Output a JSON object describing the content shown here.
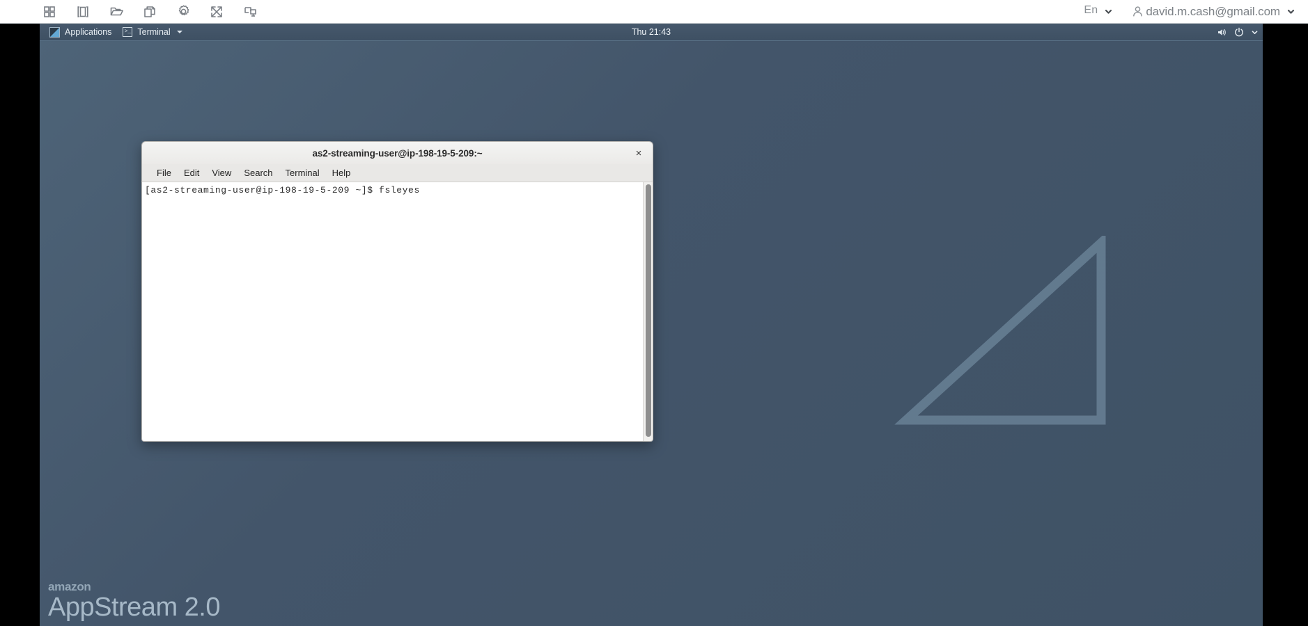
{
  "appstream_toolbar": {
    "icons": [
      {
        "name": "grid-apps-icon",
        "title": "Applications grid"
      },
      {
        "name": "window-panel-icon",
        "title": "Toggle panel"
      },
      {
        "name": "folder-open-icon",
        "title": "My Files"
      },
      {
        "name": "copy-pages-icon",
        "title": "Clipboard"
      },
      {
        "name": "gear-icon",
        "title": "Settings"
      },
      {
        "name": "fullscreen-expand-icon",
        "title": "Fullscreen"
      },
      {
        "name": "multi-monitor-icon",
        "title": "Displays"
      }
    ],
    "language_label": "En",
    "user_email": "david.m.cash@gmail.com",
    "language_caret": "chevron-down-icon",
    "user_caret": "chevron-down-icon"
  },
  "xfce_panel": {
    "applications_label": "Applications",
    "terminal_label": "Terminal",
    "terminal_icon_glyph": ">_",
    "clock": "Thu 21:43",
    "tray": [
      {
        "name": "volume-icon"
      },
      {
        "name": "power-icon"
      },
      {
        "name": "chevron-down-icon"
      }
    ]
  },
  "terminal": {
    "title": "as2-streaming-user@ip-198-19-5-209:~",
    "close_label": "×",
    "menus": [
      "File",
      "Edit",
      "View",
      "Search",
      "Terminal",
      "Help"
    ],
    "content": "[as2-streaming-user@ip-198-19-5-209 ~]$ fsleyes"
  },
  "watermark": {
    "brand": "amazon",
    "product": "AppStream 2.0"
  },
  "colors": {
    "desktop_top": "#4e6478",
    "desktop_bottom": "#3f5265",
    "panel": "#3e5063",
    "toolbar_bg": "#ffffff",
    "terminal_bg": "#ffffff",
    "accent_blue": "#63a8d4"
  }
}
